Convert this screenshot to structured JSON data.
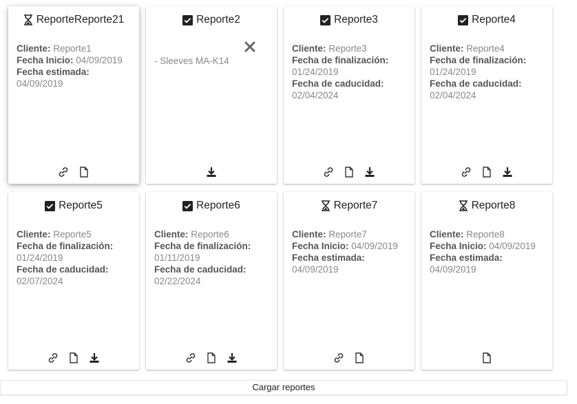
{
  "reports": [
    {
      "title": "ReporteReporte21",
      "status_icon": "hourglass-icon",
      "fields": [
        {
          "label": "Cliente:",
          "value": "Reporte1"
        },
        {
          "label": "Fecha Inicio:",
          "value": "04/09/2019"
        },
        {
          "label": "Fecha estimada:",
          "value": "04/09/2019"
        }
      ],
      "actions": [
        "link-icon",
        "document-icon"
      ]
    },
    {
      "title": "Reporte2",
      "status_icon": "checkbox-checked-icon",
      "note": "- Sleeves MA-K14",
      "has_remove": true,
      "actions": [
        "download-icon"
      ]
    },
    {
      "title": "Reporte3",
      "status_icon": "checkbox-checked-icon",
      "fields": [
        {
          "label": "Cliente:",
          "value": "Reporte3"
        },
        {
          "label": "Fecha de finalización:",
          "value": "01/24/2019"
        },
        {
          "label": "Fecha de caducidad:",
          "value": "02/04/2024"
        }
      ],
      "actions": [
        "link-icon",
        "document-icon",
        "download-icon"
      ]
    },
    {
      "title": "Reporte4",
      "status_icon": "checkbox-checked-icon",
      "fields": [
        {
          "label": "Cliente:",
          "value": "Reporte4"
        },
        {
          "label": "Fecha de finalización:",
          "value": "01/24/2019"
        },
        {
          "label": "Fecha de caducidad:",
          "value": "02/04/2024"
        }
      ],
      "actions": [
        "link-icon",
        "document-icon",
        "download-icon"
      ]
    },
    {
      "title": "Reporte5",
      "status_icon": "checkbox-checked-icon",
      "fields": [
        {
          "label": "Cliente:",
          "value": "Reporte5"
        },
        {
          "label": "Fecha de finalización:",
          "value": "01/24/2019"
        },
        {
          "label": "Fecha de caducidad:",
          "value": "02/07/2024"
        }
      ],
      "actions": [
        "link-icon",
        "document-icon",
        "download-icon"
      ]
    },
    {
      "title": "Reporte6",
      "status_icon": "checkbox-checked-icon",
      "fields": [
        {
          "label": "Cliente:",
          "value": "Reporte6"
        },
        {
          "label": "Fecha de finalización:",
          "value": "01/11/2019"
        },
        {
          "label": "Fecha de caducidad:",
          "value": "02/22/2024"
        }
      ],
      "actions": [
        "link-icon",
        "document-icon",
        "download-icon"
      ]
    },
    {
      "title": "Reporte7",
      "status_icon": "hourglass-icon",
      "fields": [
        {
          "label": "Cliente:",
          "value": "Reporte7"
        },
        {
          "label": "Fecha Inicio:",
          "value": "04/09/2019"
        },
        {
          "label": "Fecha estimada:",
          "value": "04/09/2019"
        }
      ],
      "actions": [
        "link-icon",
        "document-icon"
      ]
    },
    {
      "title": "Reporte8",
      "status_icon": "hourglass-icon",
      "fields": [
        {
          "label": "Cliente:",
          "value": "Reporte8"
        },
        {
          "label": "Fecha Inicio:",
          "value": "04/09/2019"
        },
        {
          "label": "Fecha estimada:",
          "value": "04/09/2019"
        }
      ],
      "actions": [
        "document-icon"
      ]
    }
  ],
  "load_button_label": "Cargar reportes"
}
